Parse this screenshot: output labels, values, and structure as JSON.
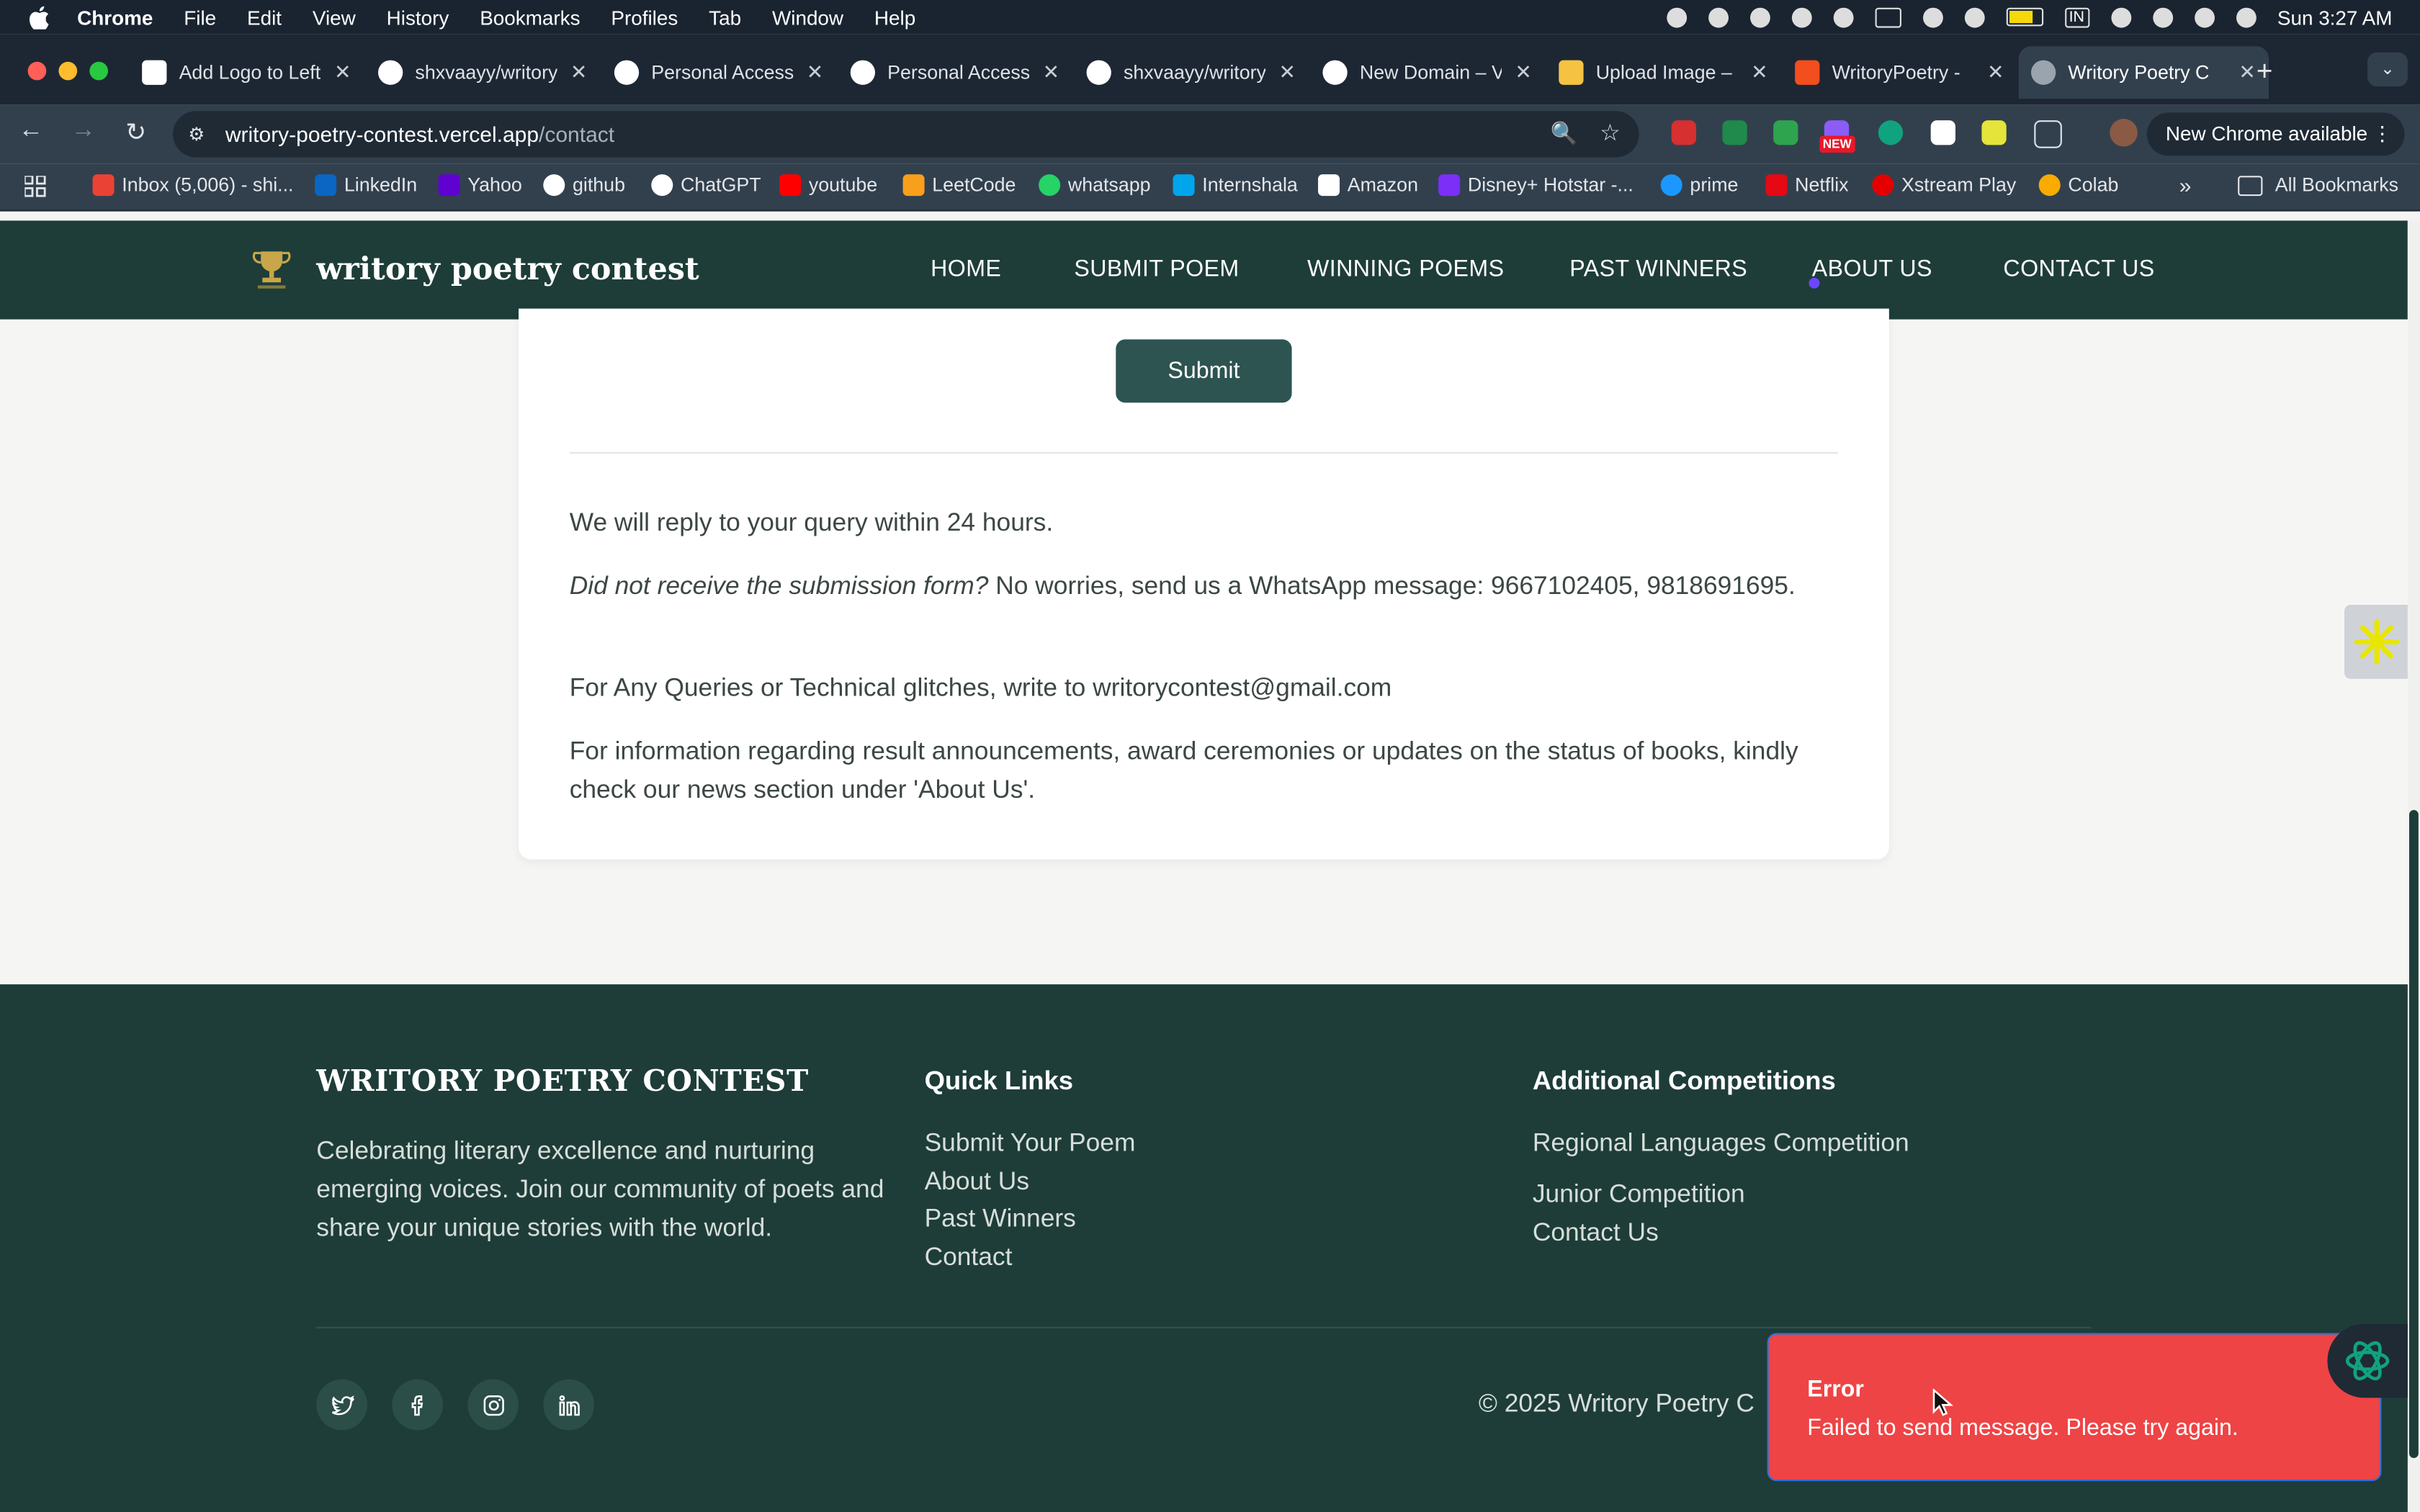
{
  "os_menubar": {
    "app_name": "Chrome",
    "menus": [
      "File",
      "Edit",
      "View",
      "History",
      "Bookmarks",
      "Profiles",
      "Tab",
      "Window",
      "Help"
    ],
    "keyboard_indicator": "IN",
    "datetime": "Sun 3:27 AM"
  },
  "browser": {
    "tabs": [
      {
        "label": "Add Logo to Left",
        "icon": "notion-icon"
      },
      {
        "label": "shxvaayy/writory",
        "icon": "github-icon"
      },
      {
        "label": "Personal Access",
        "icon": "github-icon"
      },
      {
        "label": "Personal Access",
        "icon": "github-icon"
      },
      {
        "label": "shxvaayy/writory",
        "icon": "github-icon"
      },
      {
        "label": "New Domain – V",
        "icon": "vercel-icon"
      },
      {
        "label": "Upload Image –",
        "icon": "upload-icon"
      },
      {
        "label": "WritoryPoetry -",
        "icon": "figma-icon"
      },
      {
        "label": "Writory Poetry C",
        "icon": "globe-icon",
        "active": true
      }
    ],
    "url_host": "writory-poetry-contest.vercel.app",
    "url_path": "/contact",
    "badge_new": "NEW",
    "update_button": "New Chrome available",
    "bookmarks": [
      {
        "label": "Inbox (5,006) - shi...",
        "icon": "gmail-icon",
        "color": "#ea4335"
      },
      {
        "label": "LinkedIn",
        "icon": "linkedin-icon",
        "color": "#0a66c2"
      },
      {
        "label": "Yahoo",
        "icon": "yahoo-icon",
        "color": "#6001d2"
      },
      {
        "label": "github",
        "icon": "github-icon",
        "color": "#ffffff"
      },
      {
        "label": "ChatGPT",
        "icon": "openai-icon",
        "color": "#ffffff"
      },
      {
        "label": "youtube",
        "icon": "youtube-icon",
        "color": "#ff0000"
      },
      {
        "label": "LeetCode",
        "icon": "leetcode-icon",
        "color": "#f89f1b"
      },
      {
        "label": "whatsapp",
        "icon": "whatsapp-icon",
        "color": "#25d366"
      },
      {
        "label": "Internshala",
        "icon": "internshala-icon",
        "color": "#00a5ec"
      },
      {
        "label": "Amazon",
        "icon": "amazon-icon",
        "color": "#ffffff"
      },
      {
        "label": "Disney+ Hotstar -...",
        "icon": "hotstar-icon",
        "color": "#7b2ff7"
      },
      {
        "label": "prime",
        "icon": "prime-icon",
        "color": "#1a98ff"
      },
      {
        "label": "Netflix",
        "icon": "netflix-icon",
        "color": "#e50914"
      },
      {
        "label": "Xstream Play",
        "icon": "airtel-icon",
        "color": "#e40000"
      },
      {
        "label": "Colab",
        "icon": "colab-icon",
        "color": "#f9ab00"
      }
    ],
    "all_bookmarks": "All Bookmarks"
  },
  "site": {
    "brand": "writory poetry contest",
    "nav": [
      "HOME",
      "SUBMIT POEM",
      "WINNING POEMS",
      "PAST WINNERS",
      "ABOUT US",
      "CONTACT US"
    ],
    "submit_label": "Submit",
    "info": {
      "reply": "We will reply to your query within 24 hours.",
      "whatsapp_q": "Did not receive the submission form?",
      "whatsapp_text": " No worries, send us a WhatsApp message: 9667102405, 9818691695.",
      "queries": "For Any Queries or Technical glitches, write to writorycontest@gmail.com",
      "results": "For information regarding result announcements, award ceremonies or updates on the status of books, kindly check our news section under 'About Us'."
    },
    "footer": {
      "brand": "WRITORY POETRY CONTEST",
      "description": "Celebrating literary excellence and nurturing emerging voices. Join our community of poets and share your unique stories with the world.",
      "quick_links_title": "Quick Links",
      "quick_links": [
        "Submit Your Poem",
        "About Us",
        "Past Winners",
        "Contact"
      ],
      "additional_title": "Additional Competitions",
      "additional": [
        "Regional Languages Competition",
        "Junior Competition",
        "Contact Us"
      ],
      "social": [
        "twitter-icon",
        "facebook-icon",
        "instagram-icon",
        "linkedin-icon"
      ],
      "copyright": "© 2025 Writory Poetry C"
    },
    "toast": {
      "title": "Error",
      "message": "Failed to send message. Please try again.",
      "color": "#ee4445"
    },
    "brand_color": "#1e3d38"
  }
}
